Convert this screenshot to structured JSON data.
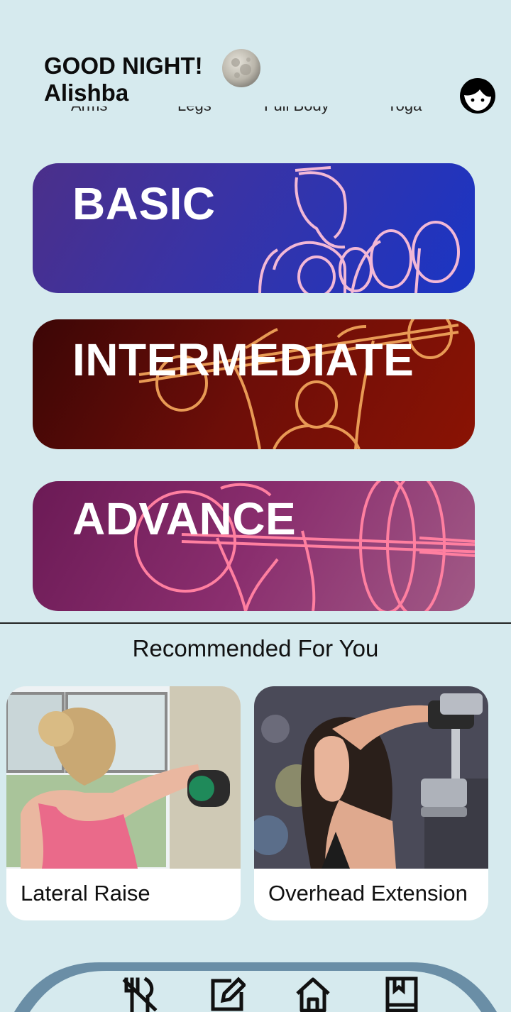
{
  "header": {
    "greeting": "GOOD NIGHT!",
    "user_name": "Alishba",
    "moon_icon": "moon-icon",
    "avatar_icon": "avatar-face-icon"
  },
  "categories": [
    "Arms",
    "Legs",
    "Full Body",
    "Yoga"
  ],
  "levels": [
    {
      "title": "BASIC",
      "color_from": "#4b2f8a",
      "color_to": "#1a35c4",
      "art_color": "#f2b8d6"
    },
    {
      "title": "INTERMEDIATE",
      "color_from": "#3c0606",
      "color_to": "#8a1304",
      "art_color": "#e89a55"
    },
    {
      "title": "ADVANCE",
      "color_from": "#6b1a55",
      "color_to": "#a15a86",
      "art_color": "#ff7fa0"
    }
  ],
  "recommended": {
    "title": "Recommended For You",
    "items": [
      {
        "label": "Lateral Raise"
      },
      {
        "label": "Overhead Extension"
      }
    ]
  },
  "nav": {
    "background": "#6a8ea6",
    "icons": [
      "diet-icon",
      "edit-note-icon",
      "home-icon",
      "book-icon"
    ]
  }
}
